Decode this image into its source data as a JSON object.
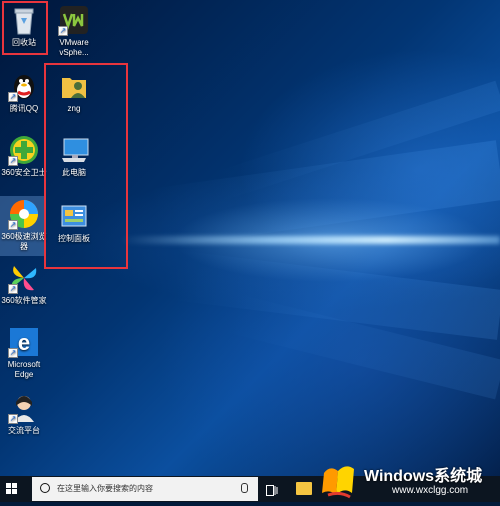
{
  "desktop": {
    "icons": [
      {
        "label": "回收站",
        "icon": "recycle-bin-icon"
      },
      {
        "label": "VMware vSphe...",
        "icon": "vmware-vsphere-icon"
      },
      {
        "label": "腾讯QQ",
        "icon": "qq-penguin-icon"
      },
      {
        "label": "zng",
        "icon": "user-folder-icon"
      },
      {
        "label": "360安全卫士",
        "icon": "360-security-icon"
      },
      {
        "label": "此电脑",
        "icon": "this-pc-icon"
      },
      {
        "label": "360极速浏览器",
        "icon": "360-browser-icon"
      },
      {
        "label": "控制面板",
        "icon": "control-panel-icon"
      },
      {
        "label": "360软件管家",
        "icon": "360-software-manager-icon"
      },
      {
        "label": "Microsoft Edge",
        "icon": "edge-icon"
      },
      {
        "label": "交流平台",
        "icon": "chat-platform-icon"
      }
    ]
  },
  "taskbar": {
    "search_placeholder": "在这里输入你要搜索的内容"
  },
  "watermark": {
    "title": "Windows系统城",
    "url": "www.wxclgg.com"
  },
  "colors": {
    "highlight_box": "#e8353d",
    "taskbar_bg": "#0c1520",
    "search_bg": "#f2f2f2"
  }
}
